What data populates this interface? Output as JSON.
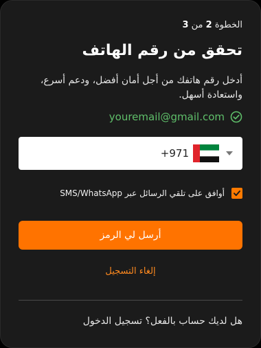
{
  "step": {
    "prefix": "الخطوة",
    "current": "2",
    "sep": "من",
    "total": "3"
  },
  "title": "تحقق من رقم الهاتف",
  "description": "أدخل رقم هاتفك من أجل أمان أفضل، ودعم أسرع، واستعادة أسهل.",
  "email": "youremail@gmail.com",
  "phone": {
    "dial_code": "+971",
    "country_flag": "uae-flag-icon",
    "value": ""
  },
  "consent": {
    "checked": true,
    "label": "أوافق على تلقي الرسائل عبر SMS/WhatsApp"
  },
  "send_button": "أرسل لي الرمز",
  "cancel_link": "إلغاء التسجيل",
  "login_prompt": "هل لديك حساب بالفعل؟ تسجيل الدخول",
  "colors": {
    "accent": "#ff7300",
    "success": "#5fbf6a",
    "card": "#1b1b1b"
  }
}
